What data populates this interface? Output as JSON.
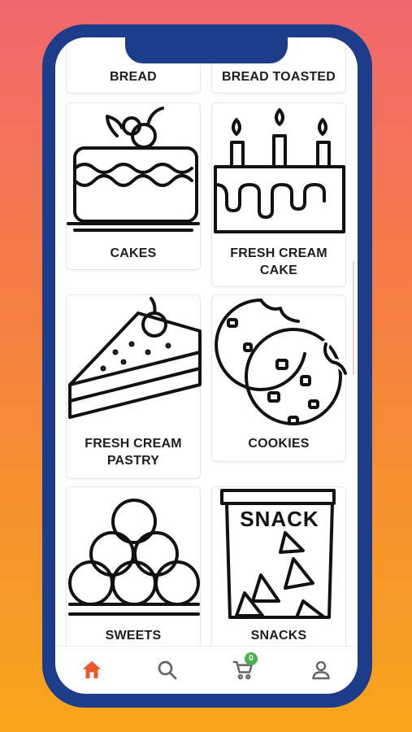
{
  "categories": [
    {
      "label_lines": [
        "BREAD"
      ]
    },
    {
      "label_lines": [
        "BREAD TOASTED"
      ]
    },
    {
      "label_lines": [
        "CAKES"
      ]
    },
    {
      "label_lines": [
        "FRESH CREAM",
        "CAKE"
      ]
    },
    {
      "label_lines": [
        "FRESH CREAM",
        "PASTRY"
      ]
    },
    {
      "label_lines": [
        "COOKIES"
      ]
    },
    {
      "label_lines": [
        "SWEETS"
      ]
    },
    {
      "label_lines": [
        "SNACKS"
      ]
    }
  ],
  "snack_bag_text": "SNACK",
  "nav": {
    "items": [
      {
        "name": "home",
        "icon": "home-icon",
        "active": true
      },
      {
        "name": "search",
        "icon": "search-icon",
        "active": false
      },
      {
        "name": "cart",
        "icon": "cart-icon",
        "active": false
      },
      {
        "name": "account",
        "icon": "person-icon",
        "active": false
      }
    ],
    "cart_count": "0"
  },
  "colors": {
    "frame": "#1d3d8b",
    "active_nav": "#e85a2b",
    "badge": "#4caf50"
  }
}
